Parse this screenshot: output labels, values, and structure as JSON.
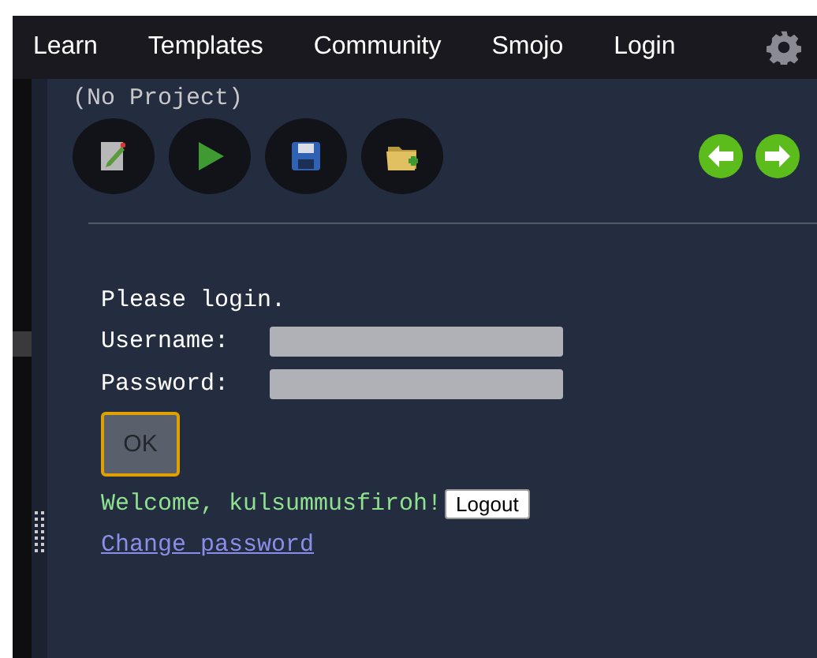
{
  "nav": {
    "items": [
      "Learn",
      "Templates",
      "Community",
      "Smojo",
      "Login"
    ]
  },
  "project": {
    "title": "(No Project)"
  },
  "login": {
    "prompt": "Please login.",
    "fields": [
      {
        "label": "Username:"
      },
      {
        "label": "Password:"
      }
    ],
    "ok_button": {
      "label": "OK",
      "disabled": true
    },
    "welcome": "Welcome, kulsummusfiroh!",
    "logout_button": "Logout",
    "change_password_link": "Change password"
  }
}
